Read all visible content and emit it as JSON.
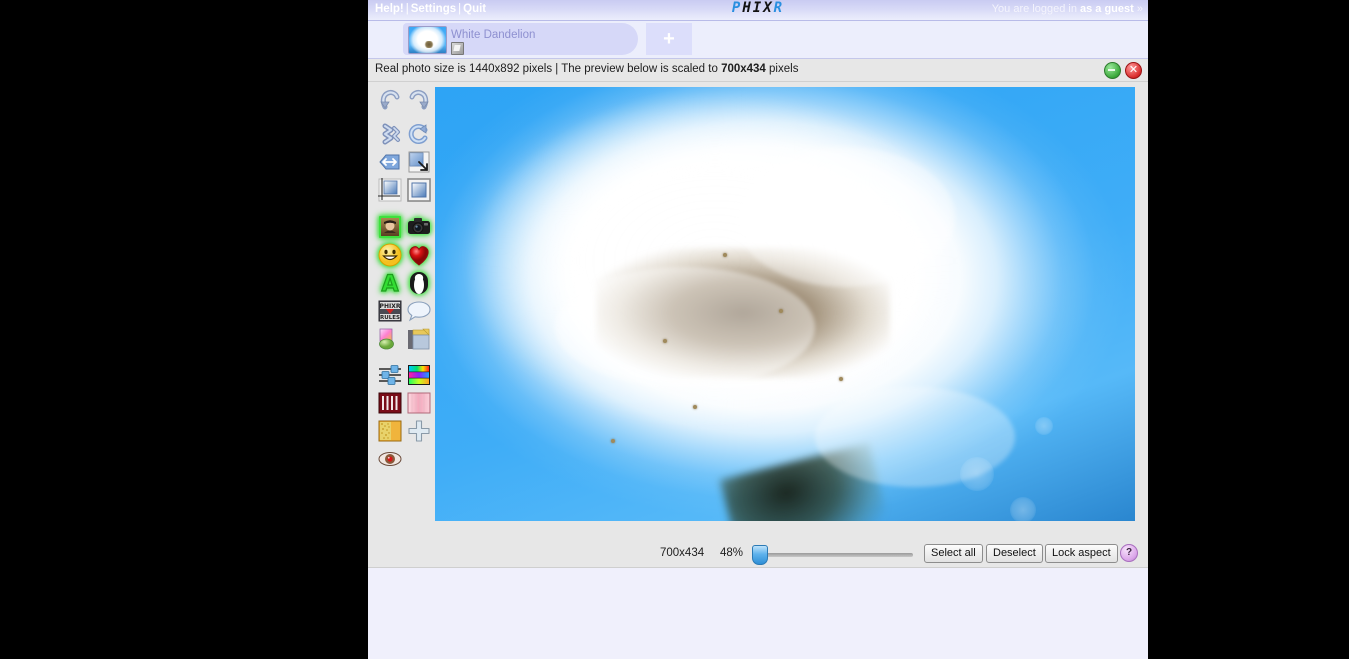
{
  "menubar": {
    "help": "Help!",
    "settings": "Settings",
    "quit": "Quit",
    "separator": "|",
    "logo_blue_1": "P",
    "logo_black": "HIX",
    "logo_blue_2": "R",
    "login_prefix": "You are logged in ",
    "login_status": "as a guest",
    "login_suffix": " »"
  },
  "tabs": {
    "open": [
      {
        "label": "White Dandelion",
        "thumb_icon": "photo-thumbnail",
        "badge_icon": "edit-layer-icon"
      }
    ],
    "new_tab_glyph": "+",
    "new_tab_name": "new-tab-button"
  },
  "infobar": {
    "text_part1": "Real photo size is 1440x892 pixels | The preview below is scaled to ",
    "text_bold": "700x434",
    "text_part2": " pixels",
    "real_size": "1440x892",
    "preview_size": "700x434",
    "minimize_icon": "minimize-icon",
    "close_glyph": "✕"
  },
  "toolbar": {
    "groups": [
      {
        "name": "transform",
        "items": [
          {
            "name": "undo-icon",
            "label": "Undo"
          },
          {
            "name": "redo-icon",
            "label": "Redo"
          },
          {
            "name": "flip-icon",
            "label": "Flip"
          },
          {
            "name": "rotate-icon",
            "label": "Rotate"
          },
          {
            "name": "move-resize-icon",
            "label": "Move"
          },
          {
            "name": "scale-icon",
            "label": "Scale"
          },
          {
            "name": "crop-icon",
            "label": "Crop"
          },
          {
            "name": "frame-select-icon",
            "label": "Select"
          }
        ]
      },
      {
        "name": "effects",
        "items": [
          {
            "name": "vintage-photo-icon",
            "label": "Vintage"
          },
          {
            "name": "camera-icon",
            "label": "Camera"
          },
          {
            "name": "smiley-icon",
            "label": "Smiley"
          },
          {
            "name": "heart-icon",
            "label": "Heart"
          },
          {
            "name": "text-letter-icon",
            "label": "Text"
          },
          {
            "name": "portrait-icon",
            "label": "Portrait"
          },
          {
            "name": "phixr-rules-stamp-icon",
            "label": "Stamp"
          },
          {
            "name": "speech-bubble-icon",
            "label": "Speech bubble"
          },
          {
            "name": "shapes-icon",
            "label": "Shapes"
          },
          {
            "name": "border-frame-icon",
            "label": "Frame"
          }
        ]
      },
      {
        "name": "adjustments",
        "items": [
          {
            "name": "sliders-icon",
            "label": "Adjust"
          },
          {
            "name": "color-bars-icon",
            "label": "Colors"
          },
          {
            "name": "red-bars-icon",
            "label": "Levels"
          },
          {
            "name": "pink-gradient-icon",
            "label": "Tint"
          },
          {
            "name": "texture-icon",
            "label": "Texture"
          },
          {
            "name": "sharpen-plus-icon",
            "label": "Sharpen"
          },
          {
            "name": "red-eye-icon",
            "label": "Red eye"
          }
        ]
      }
    ]
  },
  "bottombar": {
    "dimensions": "700x434",
    "zoom_percent": "48%",
    "slider_value": 3,
    "select_all": "Select all",
    "deselect": "Deselect",
    "lock_aspect": "Lock aspect",
    "help_glyph": "?"
  },
  "colors": {
    "menubar_top": "#c9cbf2",
    "tabstrip_bg": "#eceefc",
    "tab_active": "#d6d8f8",
    "infobar_bg": "#e7e7e7",
    "page_bg": "#f0f0fc",
    "logo_blue": "#2a8fe0",
    "sky_blue": "#2fa2f2",
    "outer_bg": "#000000"
  }
}
